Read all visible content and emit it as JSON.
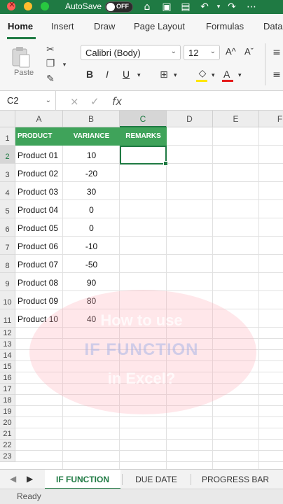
{
  "titlebar": {
    "autosave_label": "AutoSave",
    "toggle_state": "OFF"
  },
  "ribbon_tabs": [
    "Home",
    "Insert",
    "Draw",
    "Page Layout",
    "Formulas",
    "Data"
  ],
  "ribbon": {
    "paste_label": "Paste",
    "font_name": "Calibri (Body)",
    "font_size": "12",
    "grow_label": "A^",
    "shrink_label": "Aˇ",
    "bold": "B",
    "italic": "I",
    "underline": "U",
    "font_color_label": "A"
  },
  "formula_bar": {
    "name_box": "C2",
    "cancel": "×",
    "enter": "✓",
    "fx": "fx",
    "formula": ""
  },
  "columns": [
    "A",
    "B",
    "C",
    "D",
    "E",
    "F"
  ],
  "rows": [
    "1",
    "2",
    "3",
    "4",
    "5",
    "6",
    "7",
    "8",
    "9",
    "10",
    "11",
    "12",
    "13",
    "14",
    "15",
    "16",
    "17",
    "18",
    "19",
    "20",
    "21",
    "22",
    "23"
  ],
  "header_row": {
    "product": "PRODUCT",
    "variance": "VARIANCE",
    "remarks": "REMARKS"
  },
  "table": [
    {
      "product": "Product 01",
      "variance": "10"
    },
    {
      "product": "Product 02",
      "variance": "-20"
    },
    {
      "product": "Product 03",
      "variance": "30"
    },
    {
      "product": "Product 04",
      "variance": "0"
    },
    {
      "product": "Product 05",
      "variance": "0"
    },
    {
      "product": "Product 06",
      "variance": "-10"
    },
    {
      "product": "Product 07",
      "variance": "-50"
    },
    {
      "product": "Product 08",
      "variance": "90"
    },
    {
      "product": "Product 09",
      "variance": "80"
    },
    {
      "product": "Product 10",
      "variance": "40"
    }
  ],
  "watermark": {
    "line1": "How to use",
    "line2": "IF FUNCTION",
    "line3": "in Excel?"
  },
  "sheet_tabs": [
    "IF FUNCTION",
    "DUE DATE",
    "PROGRESS BAR"
  ],
  "status": {
    "text": "Ready"
  },
  "colors": {
    "accent": "#1f7a43",
    "header_fill": "#3fa35a"
  }
}
